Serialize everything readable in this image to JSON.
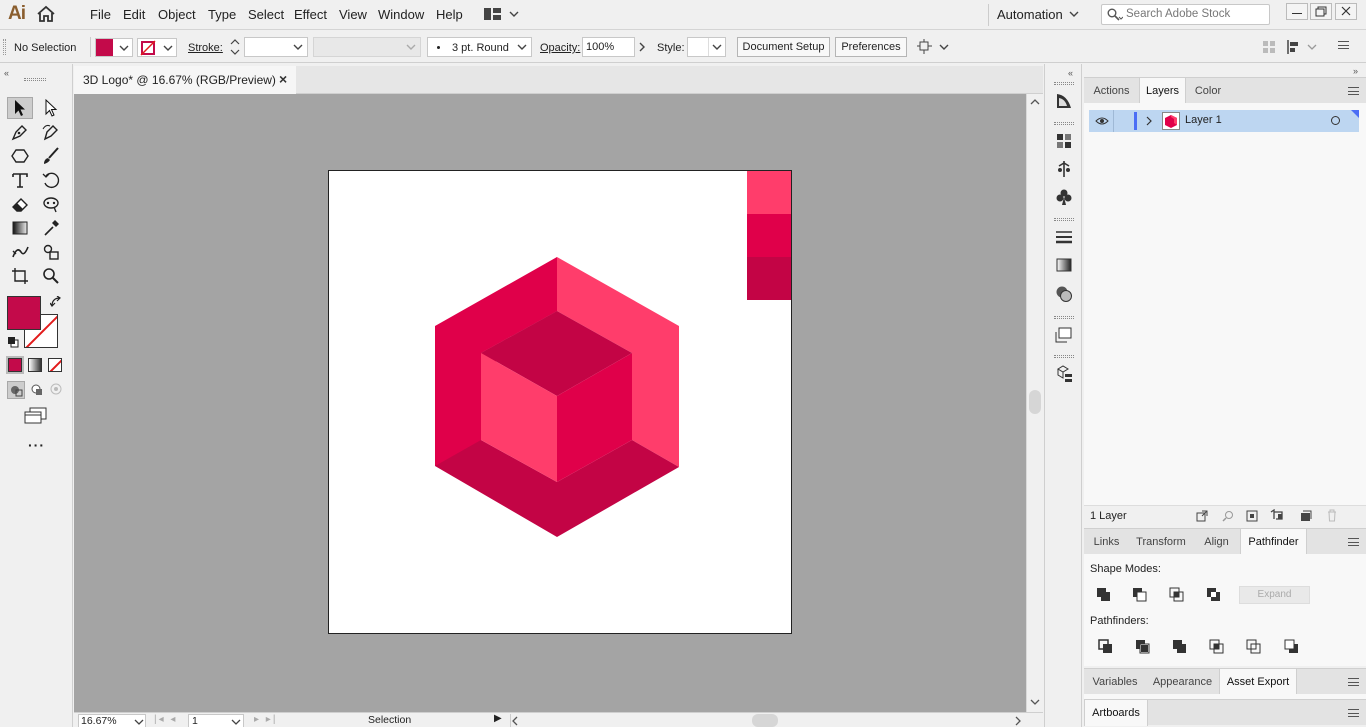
{
  "app": {
    "logo": "Ai",
    "menus": [
      "File",
      "Edit",
      "Object",
      "Type",
      "Select",
      "Effect",
      "View",
      "Window",
      "Help"
    ],
    "workspace": "Automation",
    "search_placeholder": "Search Adobe Stock"
  },
  "control_bar": {
    "selection": "No Selection",
    "fill_color": "#c30a4a",
    "stroke_label": "Stroke:",
    "brush": "3 pt. Round",
    "opacity_label": "Opacity:",
    "opacity": "100%",
    "style_label": "Style:",
    "document_setup": "Document Setup",
    "preferences": "Preferences"
  },
  "document": {
    "tab_title": "3D Logo* @ 16.67% (RGB/Preview)",
    "close": "×"
  },
  "status": {
    "zoom": "16.67%",
    "artboard_number": "1",
    "tool": "Selection"
  },
  "palette": {
    "light": "#ff3d6b",
    "medium": "#e0004a",
    "dark": "#c30445"
  },
  "layers_panel": {
    "tabs": [
      "Actions",
      "Layers",
      "Color"
    ],
    "active_tab": "Layers",
    "layers": [
      {
        "name": "Layer 1"
      }
    ],
    "count": "1 Layer"
  },
  "pathfinder_panel": {
    "tabs": [
      "Links",
      "Transform",
      "Align",
      "Pathfinder"
    ],
    "active_tab": "Pathfinder",
    "shape_modes_label": "Shape Modes:",
    "expand": "Expand",
    "pathfinders_label": "Pathfinders:"
  },
  "asset_panel": {
    "tabs": [
      "Variables",
      "Appearance",
      "Asset Export"
    ],
    "active_tab": "Asset Export"
  },
  "artboards_panel": {
    "tab": "Artboards"
  }
}
